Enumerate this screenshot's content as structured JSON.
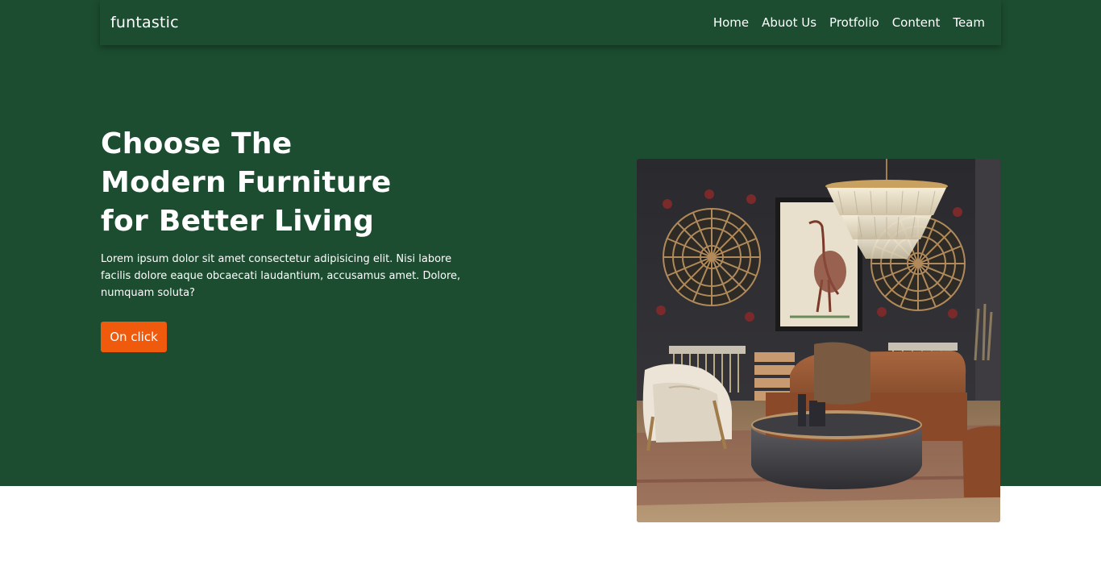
{
  "nav": {
    "brand": "funtastic",
    "links": [
      "Home",
      "Abuot Us",
      "Protfolio",
      "Content",
      "Team"
    ]
  },
  "hero": {
    "headline_lines": [
      "Choose The",
      "Modern Furniture",
      "for Better Living"
    ],
    "body": "Lorem ipsum dolor sit amet consectetur adipisicing elit. Nisi labore facilis dolore eaque obcaecati laudantium, accusamus amet. Dolore, numquam soluta?",
    "cta_label": "On click"
  },
  "colors": {
    "hero_background": "#1c4d30",
    "cta_background": "#f05a0c",
    "text": "#ffffff"
  }
}
